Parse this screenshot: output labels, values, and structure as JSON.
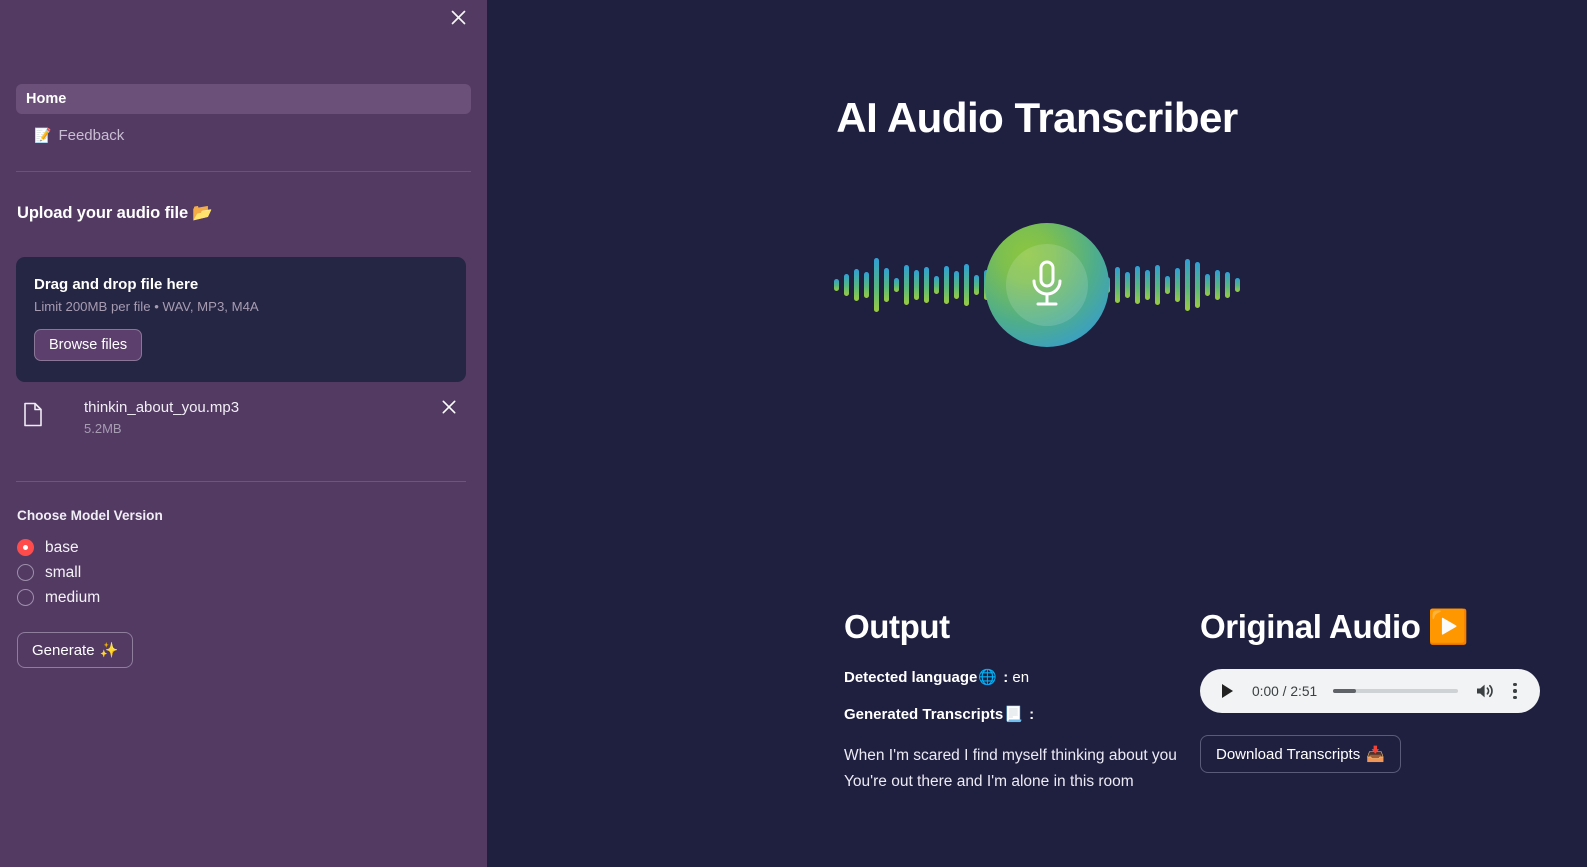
{
  "sidebar": {
    "close_icon": "close-icon",
    "nav": [
      {
        "label": "Home",
        "icon": "",
        "active": true
      },
      {
        "label": "Feedback",
        "icon": "📝",
        "active": false
      }
    ],
    "upload": {
      "heading": "Upload your audio file",
      "heading_emoji": "📂",
      "dropzone_title": "Drag and drop file here",
      "dropzone_limit": "Limit 200MB per file • WAV, MP3, M4A",
      "browse_label": "Browse files"
    },
    "file": {
      "name": "thinkin_about_you.mp3",
      "size": "5.2MB",
      "remove_icon": "×"
    },
    "model": {
      "label": "Choose Model Version",
      "options": [
        {
          "label": "base",
          "selected": true
        },
        {
          "label": "small",
          "selected": false
        },
        {
          "label": "medium",
          "selected": false
        }
      ]
    },
    "generate": {
      "label": "Generate",
      "emoji": "✨"
    }
  },
  "main": {
    "title": "AI Audio Transcriber",
    "output": {
      "heading": "Output",
      "detected_language_label": "Detected language",
      "detected_language_emoji": "🌐",
      "detected_language_sep": " : ",
      "detected_language_value": "en",
      "transcripts_label": "Generated Transcripts",
      "transcripts_emoji": "📃",
      "transcripts_sep": " :",
      "transcript_lines": [
        "When I'm scared I find myself thinking about you",
        "You're out there and I'm alone in this room"
      ]
    },
    "audio": {
      "heading": "Original Audio",
      "heading_emoji": "▶️",
      "current_time": "0:00",
      "duration": "2:51",
      "time_display": "0:00 / 2:51",
      "progress_percent": 18,
      "download_label": "Download Transcripts",
      "download_emoji": "📥"
    }
  },
  "colors": {
    "sidebar_bg": "#533a63",
    "sidebar_active": "#6b5179",
    "main_bg": "#1f2040",
    "dropzone_bg": "#252544",
    "radio_accent": "#ff4b4b",
    "player_bg": "#f1f3f4"
  }
}
